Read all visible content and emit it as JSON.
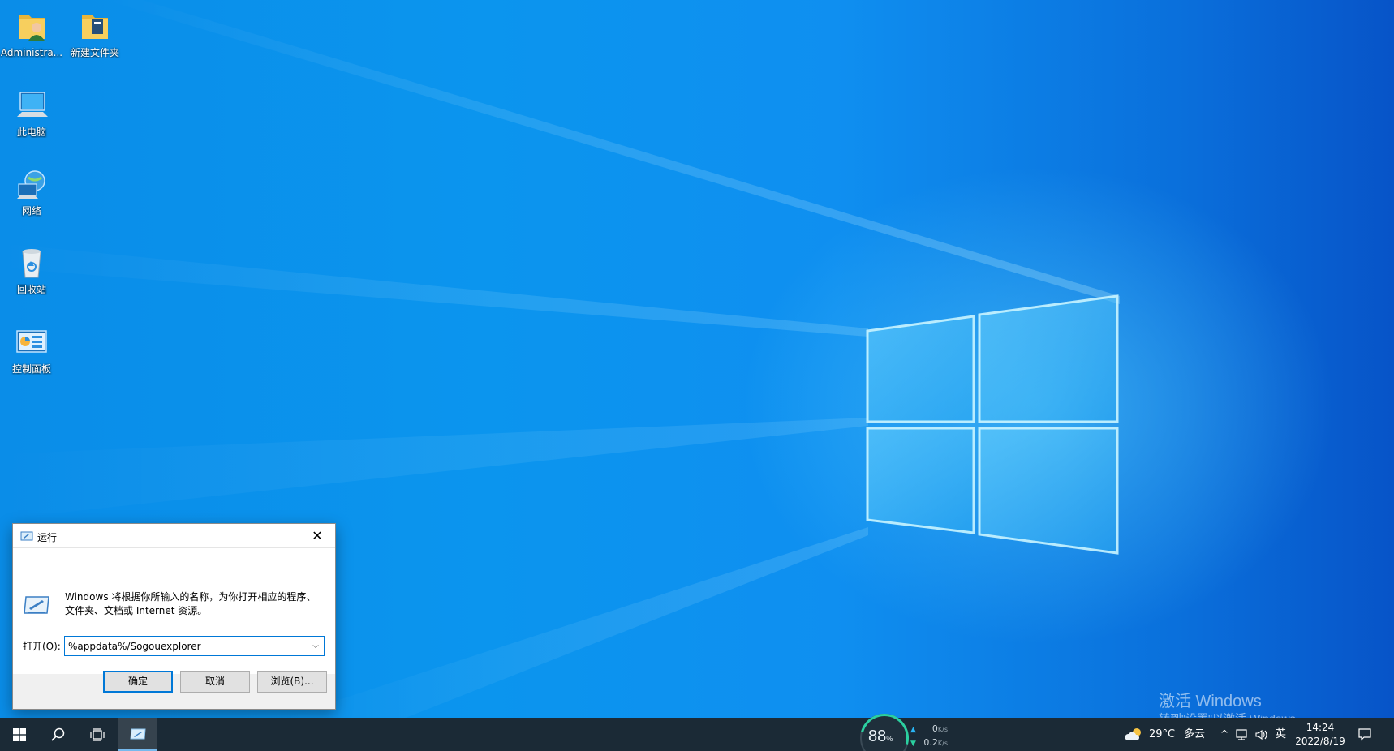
{
  "desktop": {
    "icons": [
      {
        "label": "Administra...",
        "icon": "user-folder-icon"
      },
      {
        "label": "新建文件夹",
        "icon": "folder-icon"
      },
      {
        "label": "此电脑",
        "icon": "computer-icon"
      },
      {
        "label": "网络",
        "icon": "network-icon"
      },
      {
        "label": "回收站",
        "icon": "recycle-bin-icon"
      },
      {
        "label": "控制面板",
        "icon": "control-panel-icon"
      }
    ]
  },
  "run_dialog": {
    "title": "运行",
    "close_glyph": "✕",
    "description_line1": "Windows 将根据你所输入的名称，为你打开相应的程序、",
    "description_line2": "文件夹、文档或 Internet 资源。",
    "open_label": "打开(O):",
    "open_value": "%appdata%/Sogouexplorer",
    "ok_label": "确定",
    "cancel_label": "取消",
    "browse_label": "浏览(B)..."
  },
  "watermark": {
    "line1": "激活 Windows",
    "line2": "转到\"设置\"以激活 Windows。"
  },
  "taskbar": {
    "netmon": {
      "percent": "88",
      "percent_unit": "%",
      "upload": "0",
      "download": "0.2",
      "unit": "K/s"
    },
    "weather": {
      "temp": "29°C",
      "condition": "多云"
    },
    "tray_chevron": "^",
    "ime": "英",
    "time": "14:24",
    "date": "2022/8/19"
  },
  "colors": {
    "taskbar_bg": "#1b2a36",
    "accent": "#0078d7",
    "wallpaper_blue": "#0b8de8"
  }
}
